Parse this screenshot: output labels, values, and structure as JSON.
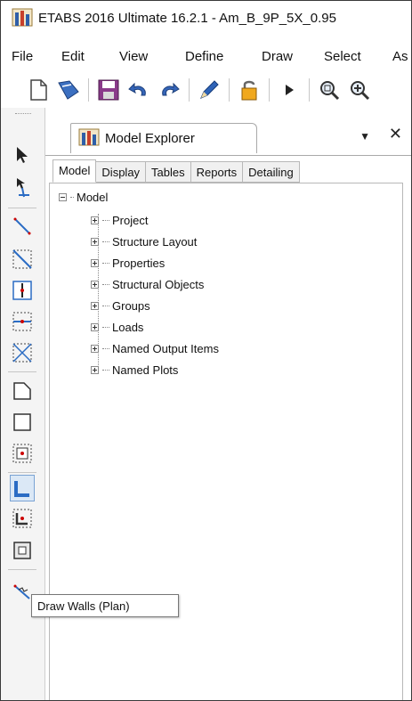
{
  "window": {
    "title": "ETABS 2016 Ultimate 16.2.1 - Am_B_9P_5X_0.95"
  },
  "menu": {
    "items": [
      "File",
      "Edit",
      "View",
      "Define",
      "Draw",
      "Select",
      "As"
    ]
  },
  "toolbar": {
    "icons": [
      "new-file-icon",
      "open-file-icon",
      "save-icon",
      "undo-icon",
      "redo-icon",
      "edit-pencil-icon",
      "lock-icon",
      "run-analysis-icon",
      "zoom-window-icon",
      "zoom-in-icon"
    ]
  },
  "side_toolbar": {
    "icons": [
      "select-pointer-icon",
      "reshape-object-icon",
      "draw-line-icon",
      "draw-brace-icon",
      "draw-column-icon",
      "draw-beam-icon",
      "draw-x-brace-icon",
      "draw-polygon-area-icon",
      "draw-rectangle-area-icon",
      "quick-draw-area-icon",
      "draw-walls-icon",
      "quick-draw-walls-icon",
      "draw-wall-opening-icon",
      "draw-link-icon"
    ],
    "active_tool": "draw-walls-icon"
  },
  "explorer": {
    "title": "Model Explorer",
    "pin_glyph": "▼",
    "close_glyph": "✕",
    "tabs": [
      "Model",
      "Display",
      "Tables",
      "Reports",
      "Detailing"
    ],
    "selected_tab": "Model",
    "root": "Model",
    "items": [
      {
        "label": "Project"
      },
      {
        "label": "Structure Layout"
      },
      {
        "label": "Properties"
      },
      {
        "label": "Structural Objects"
      },
      {
        "label": "Groups"
      },
      {
        "label": "Loads"
      },
      {
        "label": "Named Output Items"
      },
      {
        "label": "Named Plots"
      }
    ]
  },
  "tooltip": {
    "text": "Draw Walls (Plan)"
  },
  "colors": {
    "accent_blue": "#2b6cc4",
    "active_tool_bg": "#dbe8f6",
    "icon_yellow": "#e8b63c"
  }
}
